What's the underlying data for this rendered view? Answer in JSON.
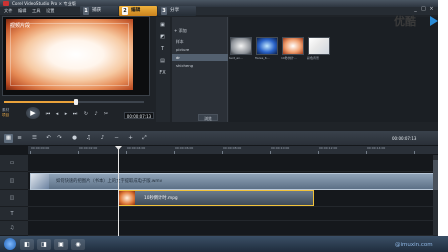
{
  "app": {
    "title": "Corel VideoStudio Pro × 专业版"
  },
  "menu": [
    "文件",
    "编辑",
    "工具",
    "设置"
  ],
  "tabs": [
    {
      "num": "1",
      "label": "捕获"
    },
    {
      "num": "2",
      "label": "编辑"
    },
    {
      "num": "3",
      "label": "分享"
    }
  ],
  "window_controls": [
    "_",
    "□",
    "×"
  ],
  "player": {
    "overlay_text": "视频片段",
    "mode_label": "素材",
    "mode_project": "项目",
    "timecode": "00:00:07:13"
  },
  "library": {
    "add_label": "+ 添加",
    "folders": [
      "样本",
      "picture",
      "dr",
      "shicheng"
    ],
    "active_folder": "dr",
    "browse_label": "浏览",
    "thumbnails": [
      {
        "label": "text_en..."
      },
      {
        "label": "flares_6..."
      },
      {
        "label": "10秒倒计..."
      },
      {
        "label": "彩色背景"
      }
    ]
  },
  "timeline": {
    "timecode": "00:00:07:13",
    "ruler_labels": [
      "00:00:00:00",
      "00:00:02:00",
      "00:00:04:00",
      "00:00:06:00",
      "00:00:08:00",
      "00:00:10:00",
      "00:00:12:00",
      "00:00:14:00",
      "00:00:16:00"
    ],
    "clip1_label": "如何快速的把图片（书本）上的文字提取成电子版.wmv",
    "clip2_label": "10秒倒计时.mpg"
  },
  "watermark": "@imuxin.com",
  "logo_text": "优酷"
}
